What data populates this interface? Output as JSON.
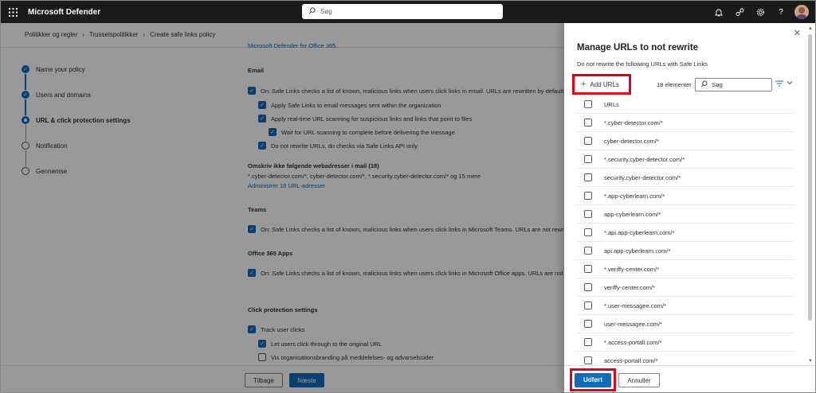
{
  "topbar": {
    "app_title": "Microsoft Defender",
    "search_placeholder": "Søg",
    "icons": [
      "bell-icon",
      "share-icon",
      "gear-icon",
      "help-icon"
    ],
    "help_glyph": "?"
  },
  "breadcrumb": [
    "Politikker og regler",
    "Trusselspolitikker",
    "Create safe links policy"
  ],
  "steps": [
    {
      "label": "Name your policy",
      "state": "done"
    },
    {
      "label": "Users and domains",
      "state": "done"
    },
    {
      "label": "URL & click protection settings",
      "state": "current"
    },
    {
      "label": "Notification",
      "state": "todo"
    },
    {
      "label": "Gennemse",
      "state": "todo"
    }
  ],
  "content": {
    "top_link": "Microsoft Defender for Office 365.",
    "email_heading": "Email",
    "email_items": [
      {
        "text": "On: Safe Links checks a list of known, malicious links when users click links in email. URLs are rewritten by default.",
        "checked": true
      },
      {
        "text": "Apply Safe Links to email messages sent within the organization",
        "checked": true
      },
      {
        "text": "Apply real-time URL scanning for suspicious links and links that point to files",
        "checked": true
      },
      {
        "text": "Wait for URL scanning to complete before delivering the message",
        "checked": true
      },
      {
        "text": "Do not rewrite URLs, do checks via Safe Links API only.",
        "checked": true
      }
    ],
    "norewrite_heading": "Omskriv ikke følgende webadresser i mail (18)",
    "norewrite_list": "*.cyber-detector.com/*, cyber-detector.com/*, *.security.cyber-detector.com/* og 15 mere",
    "norewrite_link": "Administrer 18 URL-adresser",
    "teams_heading": "Teams",
    "teams_item": "On: Safe Links checks a list of known, malicious links when users click links in Microsoft Teams. URLs are not rewritten.",
    "o365_heading": "Office 365 Apps",
    "o365_item": "On: Safe Links checks a list of known, malicious links when users click links in Microsoft Office apps. URLs are not rewritten.",
    "click_heading": "Click protection settings",
    "click_items": [
      {
        "text": "Track user clicks",
        "checked": true
      },
      {
        "text": "Let users click through to the original URL",
        "checked": true
      },
      {
        "text": "Vis organisationsbranding på meddelelses- og advarselssider",
        "checked": false
      }
    ],
    "back_button": "Tilbage",
    "next_button": "Næste"
  },
  "panel": {
    "title": "Manage URLs to not rewrite",
    "subtitle": "Do not rewrite the following URLs with Safe Links",
    "add_button": "Add URLs",
    "count": "18 elementer",
    "search_placeholder": "Søg",
    "column_header": "URLs",
    "urls": [
      "*.cyber-detector.com/*",
      "cyber-detector.com/*",
      "*.security.cyber-detector.com/*",
      "security.cyber-detector.com/*",
      "*.app-cyberlearn.com/*",
      "app-cyberlearn.com/*",
      "*.api.app-cyberlearn.com/*",
      "api.app-cyberlearn.com/*",
      "*.veriffy-center.com/*",
      "veriffy-center.com/*",
      "*.user-messagee.com/*",
      "user-messagee.com/*",
      "*.access-portall.com/*",
      "access-portall.com/*"
    ],
    "done_button": "Udført",
    "cancel_button": "Annuller"
  },
  "colors": {
    "accent": "#0f6cbd",
    "highlight": "#e0001b",
    "topbar": "#1b1b1b"
  }
}
